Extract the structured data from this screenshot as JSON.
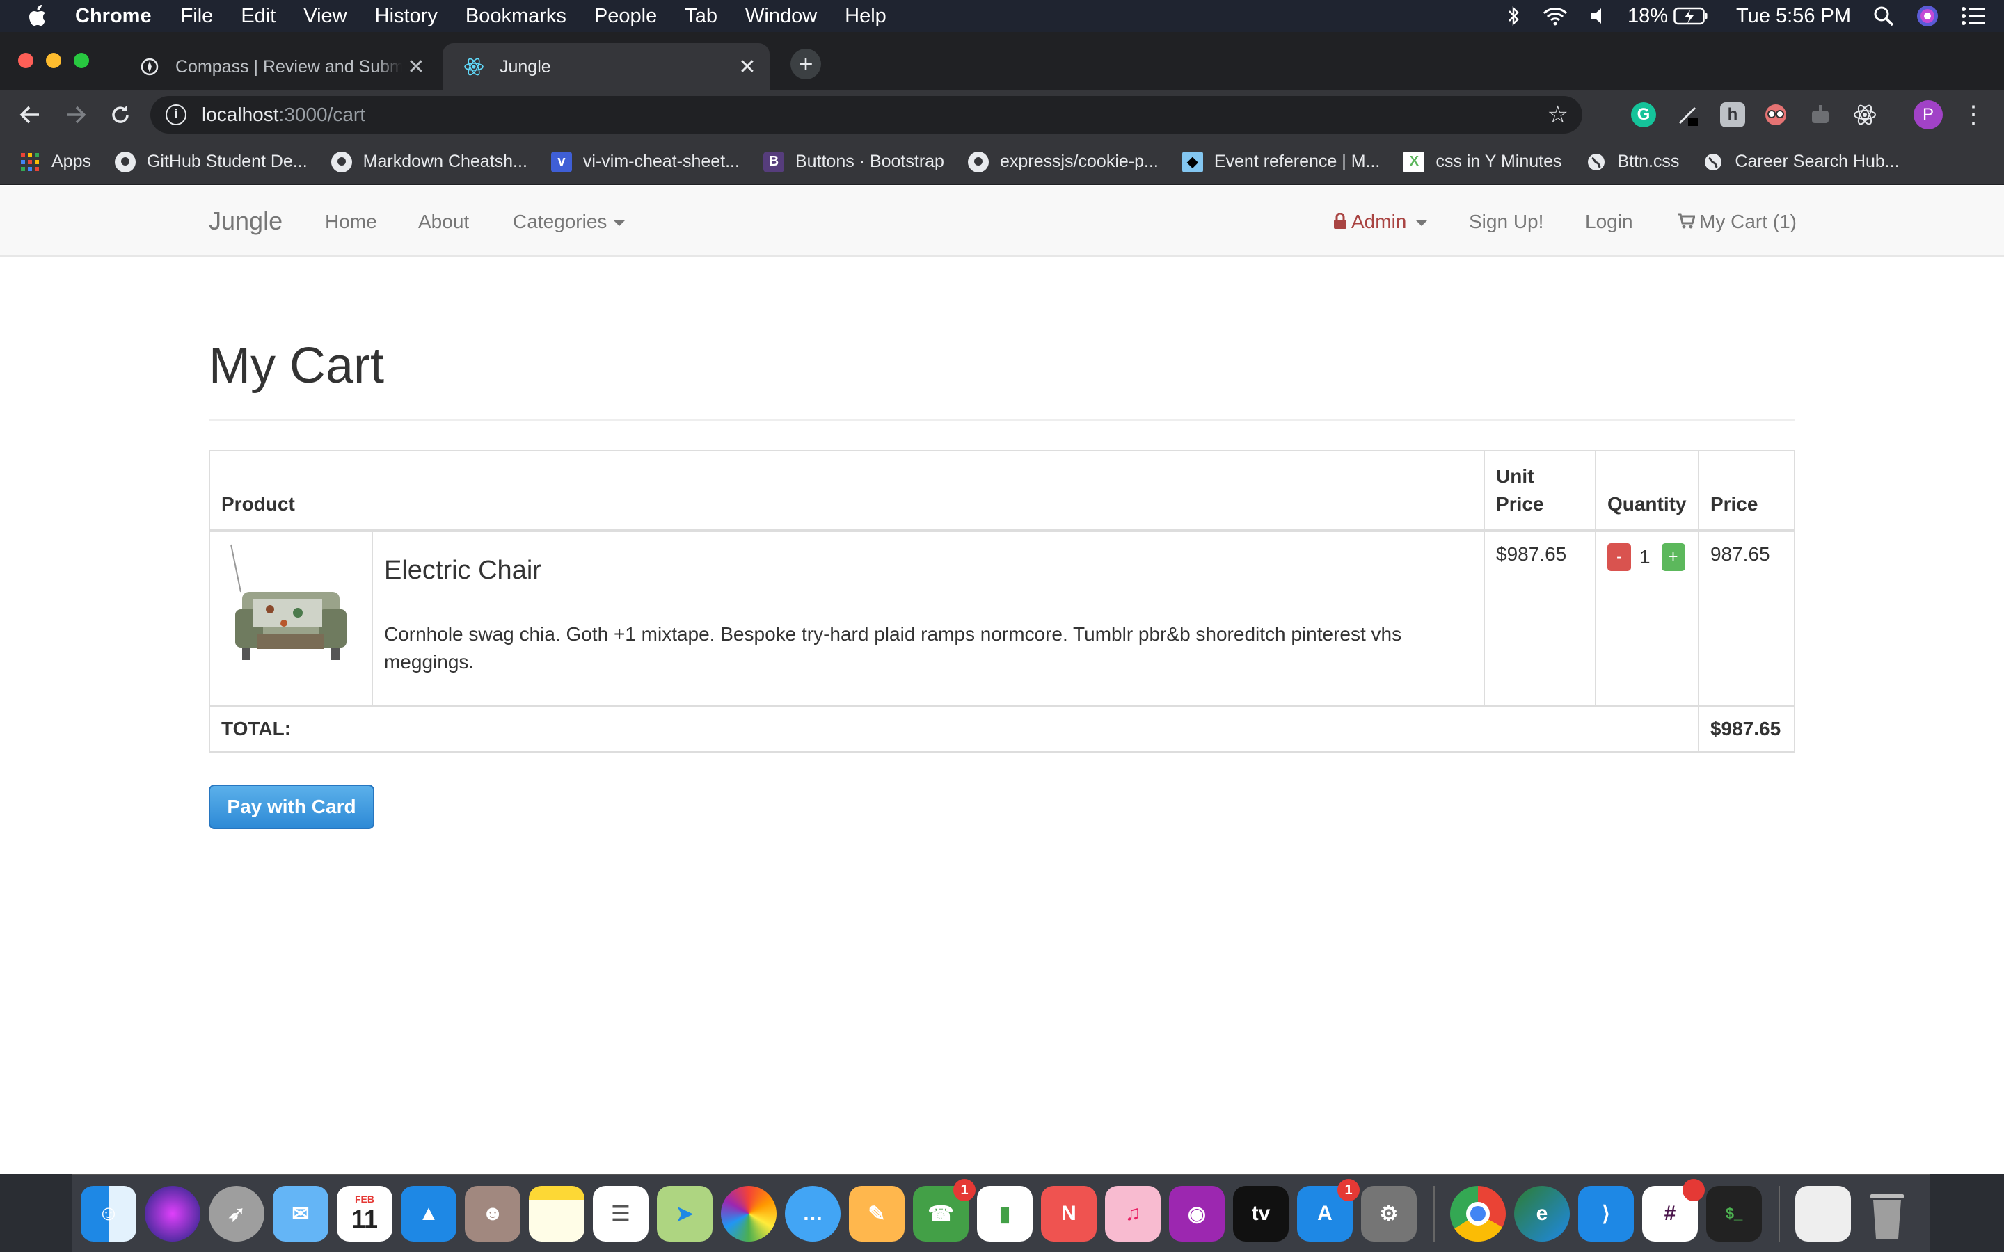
{
  "menubar": {
    "app_name": "Chrome",
    "menus": [
      "File",
      "Edit",
      "View",
      "History",
      "Bookmarks",
      "People",
      "Tab",
      "Window",
      "Help"
    ],
    "battery": "18%",
    "clock": "Tue 5:56 PM"
  },
  "tabs": [
    {
      "title": "Compass | Review and Submit Ju",
      "icon": "compass-icon"
    },
    {
      "title": "Jungle",
      "icon": "react-icon"
    }
  ],
  "address": {
    "host": "localhost",
    "path": ":3000/cart"
  },
  "profile_initial": "P",
  "bookmarks": [
    {
      "label": "Apps",
      "icon": "apps-grid-icon"
    },
    {
      "label": "GitHub Student De...",
      "icon": "github-icon"
    },
    {
      "label": "Markdown Cheatsh...",
      "icon": "github-icon"
    },
    {
      "label": "vi-vim-cheat-sheet...",
      "icon": "vim-icon"
    },
    {
      "label": "Buttons · Bootstrap",
      "icon": "bootstrap-icon"
    },
    {
      "label": "expressjs/cookie-p...",
      "icon": "github-icon"
    },
    {
      "label": "Event reference | M...",
      "icon": "mdn-icon"
    },
    {
      "label": "css in Y Minutes",
      "icon": "xy-icon"
    },
    {
      "label": "Bttn.css",
      "icon": "globe-icon"
    },
    {
      "label": "Career Search Hub...",
      "icon": "globe-icon"
    }
  ],
  "site_nav": {
    "brand": "Jungle",
    "home": "Home",
    "about": "About",
    "categories": "Categories",
    "admin": "Admin",
    "signup": "Sign Up!",
    "login": "Login",
    "cart": "My Cart (1)"
  },
  "cart": {
    "heading": "My Cart",
    "columns": {
      "product": "Product",
      "unit_price": "Unit Price",
      "quantity": "Quantity",
      "price": "Price"
    },
    "items": [
      {
        "name": "Electric Chair",
        "description": "Cornhole swag chia. Goth +1 mixtape. Bespoke try-hard plaid ramps normcore. Tumblr pbr&b shoreditch pinterest vhs meggings.",
        "unit_price": "$987.65",
        "quantity": "1",
        "minus_label": "-",
        "plus_label": "+",
        "price": "987.65"
      }
    ],
    "total_label": "TOTAL:",
    "total_value": "$987.65",
    "pay_button": "Pay with Card"
  },
  "dock": {
    "badges": {
      "facetime": "1",
      "appstore": "1"
    },
    "calendar_month": "FEB",
    "calendar_day": "11",
    "tv_label": "tv"
  },
  "colors": {
    "admin_red": "#a94442",
    "pay_blue": "#3a95de",
    "minus_red": "#d9534f",
    "plus_green": "#5cb85c"
  }
}
